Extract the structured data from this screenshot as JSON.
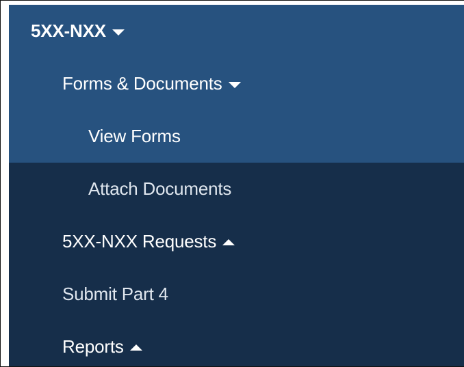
{
  "nav": {
    "colors": {
      "active_block": "#27527f",
      "dark_block": "#162e4a",
      "text": "#ffffff"
    },
    "items": [
      {
        "label": "5XX-NXX",
        "icon": "caret-down-icon"
      },
      {
        "label": "Forms & Documents",
        "icon": "caret-down-icon"
      },
      {
        "label": "View Forms"
      },
      {
        "label": "Attach Documents"
      },
      {
        "label": "5XX-NXX Requests",
        "icon": "caret-up-icon"
      },
      {
        "label": "Submit Part 4"
      },
      {
        "label": "Reports",
        "icon": "caret-up-icon"
      }
    ]
  }
}
